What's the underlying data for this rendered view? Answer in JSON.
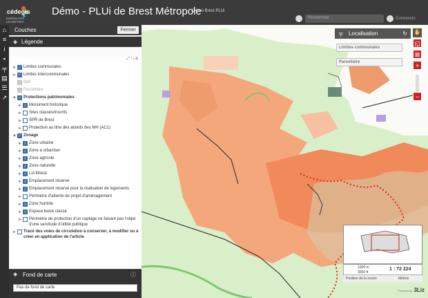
{
  "header": {
    "title": "Démo - PLUi de Brest Métropole",
    "subtitle": "Démo Brest PLUi",
    "logo_text": "cédegis",
    "logo_sub": "BUREAU DES GEOMETRES",
    "search_placeholder": "Rechercher",
    "connect_label": "Connexion"
  },
  "sidebar_icons": [
    "home-icon",
    "layers-icon",
    "info-icon",
    "comment-icon",
    "tools-icon",
    "print-icon",
    "list-icon",
    "share-icon"
  ],
  "panel": {
    "couches_label": "Couches",
    "close_label": "Fermer",
    "legend_label": "Légende"
  },
  "layers": [
    {
      "label": "Limites communales",
      "arrow": "►",
      "checked": true,
      "bold": false,
      "grey": false,
      "indent": 0
    },
    {
      "label": "Limites intercommunales",
      "arrow": "►",
      "checked": true,
      "bold": false,
      "grey": false,
      "indent": 0
    },
    {
      "label": "Bâti",
      "arrow": "",
      "checked": false,
      "bold": false,
      "grey": true,
      "indent": 0
    },
    {
      "label": "Parcellaire",
      "arrow": "",
      "checked": false,
      "bold": false,
      "grey": true,
      "indent": 0
    },
    {
      "label": "Protections patrimoniales",
      "arrow": "▼",
      "checked": true,
      "bold": true,
      "grey": false,
      "indent": 0
    },
    {
      "label": "Monument historique",
      "arrow": "►",
      "checked": true,
      "bold": false,
      "grey": false,
      "indent": 1
    },
    {
      "label": "Sites classés/inscrits",
      "arrow": "►",
      "checked": false,
      "bold": false,
      "grey": false,
      "indent": 1
    },
    {
      "label": "SPR de Brest",
      "arrow": "►",
      "checked": false,
      "bold": false,
      "grey": false,
      "indent": 1
    },
    {
      "label": "Protection au titre des abords des MH (AC1)",
      "arrow": "►",
      "checked": false,
      "bold": false,
      "grey": false,
      "indent": 1
    },
    {
      "label": "Zonage",
      "arrow": "▼",
      "checked": true,
      "bold": true,
      "grey": false,
      "indent": 0
    },
    {
      "label": "Zone urbaine",
      "arrow": "►",
      "checked": true,
      "bold": false,
      "grey": false,
      "indent": 1
    },
    {
      "label": "Zone à urbaniser",
      "arrow": "►",
      "checked": true,
      "bold": false,
      "grey": false,
      "indent": 1
    },
    {
      "label": "Zone agricole",
      "arrow": "►",
      "checked": true,
      "bold": false,
      "grey": false,
      "indent": 1
    },
    {
      "label": "Zone naturelle",
      "arrow": "►",
      "checked": true,
      "bold": false,
      "grey": false,
      "indent": 1
    },
    {
      "label": "Loi littoral",
      "arrow": "►",
      "checked": true,
      "bold": false,
      "grey": false,
      "indent": 1
    },
    {
      "label": "Emplacement réservé",
      "arrow": "►",
      "checked": true,
      "bold": false,
      "grey": false,
      "indent": 1
    },
    {
      "label": "Emplacement réservé pour la réalisation de logements",
      "arrow": "►",
      "checked": true,
      "bold": false,
      "grey": false,
      "indent": 1
    },
    {
      "label": "Périmètre d'attente de projet d'aménagement",
      "arrow": "►",
      "checked": false,
      "bold": false,
      "grey": false,
      "indent": 1
    },
    {
      "label": "Zone humide",
      "arrow": "►",
      "checked": true,
      "bold": false,
      "grey": false,
      "indent": 1
    },
    {
      "label": "Espace boisé classé",
      "arrow": "►",
      "checked": true,
      "bold": false,
      "grey": false,
      "indent": 1
    },
    {
      "label": "Périmètre de protection d'un captage ne faisant pas l'objet d'une servitude d'utilité publique",
      "arrow": "►",
      "checked": false,
      "bold": false,
      "grey": false,
      "indent": 1
    },
    {
      "label": "Tracé des voies de circulation à conserver, à modifier ou à créer en application de l'article",
      "arrow": "►",
      "checked": false,
      "bold": true,
      "grey": false,
      "indent": 0
    }
  ],
  "basemap": {
    "title": "Fond de carte",
    "selected": "Pas de fond de carte"
  },
  "map": {
    "localisation_label": "Localisation",
    "field1": "Limites communales",
    "field2": "Parcellaire",
    "scale": "1 : 72 224",
    "scale_bar_1": "1000 m",
    "scale_bar_2": "3000 ft",
    "position_label": "Position de la souris",
    "units": "Mètres",
    "credit": "3Liz",
    "powered": "Powered by"
  }
}
